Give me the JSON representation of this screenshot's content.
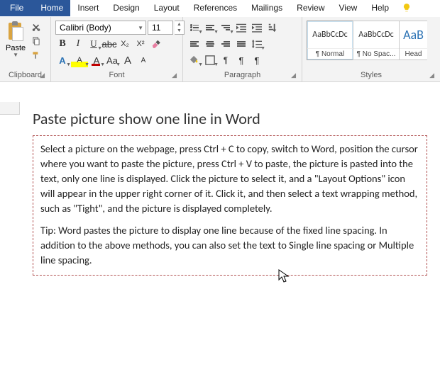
{
  "menu": {
    "tabs": [
      "File",
      "Home",
      "Insert",
      "Design",
      "Layout",
      "References",
      "Mailings",
      "Review",
      "View",
      "Help"
    ],
    "active_index": 1
  },
  "ribbon": {
    "clipboard": {
      "label": "Clipboard",
      "paste": "Paste"
    },
    "font": {
      "label": "Font",
      "name": "Calibri (Body)",
      "size": "11",
      "buttons": {
        "bold": "B",
        "italic": "I",
        "underline": "U",
        "strike": "abc",
        "sub": "X₂",
        "sup": "X²",
        "caseA": "Aa",
        "bigA": "A",
        "smallA": "A",
        "colorA": "A",
        "hlA": "A",
        "clearA": "A"
      }
    },
    "paragraph": {
      "label": "Paragraph",
      "pilcrow": "¶"
    },
    "styles": {
      "label": "Styles",
      "items": [
        {
          "preview": "AaBbCcDc",
          "name": "¶ Normal"
        },
        {
          "preview": "AaBbCcDc",
          "name": "¶ No Spac..."
        },
        {
          "preview": "AaB",
          "name": "Head"
        }
      ]
    }
  },
  "document": {
    "title": "Paste picture show one line in Word",
    "p1": "Select a picture on the webpage, press Ctrl + C to copy, switch to Word, position the cursor where you want to paste the picture, press Ctrl + V to paste, the picture is pasted into the text, only one line is displayed. Click the picture to select it, and a \"Layout Options\" icon will appear in the upper right corner of it. Click it, and then select a text wrapping method, such as \"Tight\", and the picture is displayed completely.",
    "p2": "Tip: Word pastes the picture to display one line because of the fixed line spacing. In addition to the above methods, you can also set the text to Single line spacing or Multiple line spacing."
  }
}
